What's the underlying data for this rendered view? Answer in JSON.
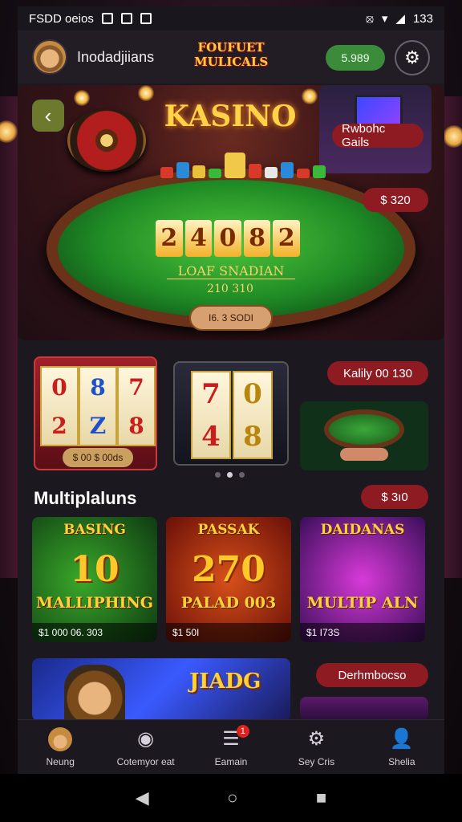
{
  "status_bar": {
    "left_text": "FSDD oeios",
    "right_text": "133"
  },
  "header": {
    "username": "Inodadjiians",
    "logo_text": "FOUFUET MULICALS",
    "balance": "5.989"
  },
  "hero": {
    "title": "KASINO",
    "top_badge": "Rwbohc Gails",
    "amount_badge": "$ 320",
    "jackpot_digits": [
      "2",
      "4",
      "0",
      "8",
      "2"
    ],
    "felt_line1": "LOAF SNADIAN",
    "felt_line2": "210 310",
    "button_label": "I6. 3 SODI"
  },
  "carousel": {
    "card1_label": "$ 00 $ 00ds",
    "card1_reels": [
      [
        "0",
        "2"
      ],
      [
        "8",
        "Z"
      ],
      [
        "7",
        "8"
      ]
    ],
    "card2_reels": [
      [
        "7",
        "4"
      ],
      [
        "0",
        "8"
      ]
    ],
    "card3_badge": "Kalily 00 130"
  },
  "section": {
    "title": "Multiplaluns",
    "badge": "$ 3ı0"
  },
  "games": [
    {
      "top": "BASING",
      "big": "10",
      "sub": "MALLIPHING",
      "foot": "$1 000 06. 303"
    },
    {
      "top": "PASSAK",
      "big": "270",
      "sub": "PALAD 003",
      "foot": "$1 50I"
    },
    {
      "top": "DAIDANAS",
      "big": "",
      "sub": "MULTIP ALN",
      "foot": "$1 I73S"
    }
  ],
  "promo": {
    "left_title": "JIADG",
    "right_badge": "Derhmbocso"
  },
  "tabs": [
    {
      "label": "Neung",
      "icon": "user-hat-icon"
    },
    {
      "label": "Cotemyor eat",
      "icon": "roulette-icon"
    },
    {
      "label": "Eamain",
      "icon": "chips-icon",
      "badge": "1"
    },
    {
      "label": "Sey Cris",
      "icon": "gear-icon"
    },
    {
      "label": "Shelia",
      "icon": "profile-icon"
    }
  ],
  "colors": {
    "accent_green": "#3c8b3a",
    "badge_red": "#8e1a22",
    "gold": "#ffd24a"
  }
}
